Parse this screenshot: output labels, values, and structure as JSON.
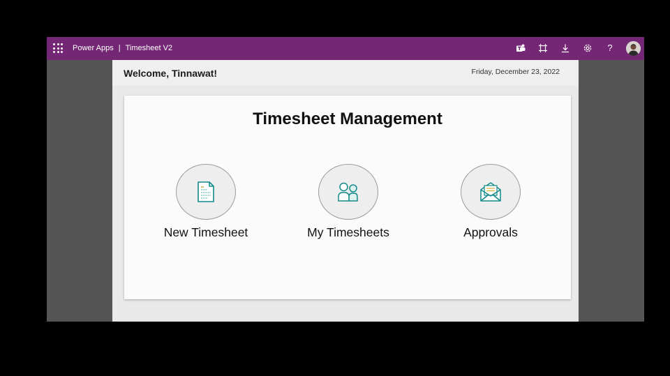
{
  "topbar": {
    "app_name": "Power Apps",
    "separator": "|",
    "app_title": "Timesheet V2",
    "icons": [
      "teams-icon",
      "fit-to-window-icon",
      "download-icon",
      "settings-icon",
      "help-icon",
      "user-avatar"
    ],
    "help_glyph": "?"
  },
  "header": {
    "welcome": "Welcome, Tinnawat!",
    "date": "Friday, December 23, 2022"
  },
  "card": {
    "title": "Timesheet Management",
    "tiles": [
      {
        "label": "New Timesheet",
        "icon": "new-timesheet-icon"
      },
      {
        "label": "My Timesheets",
        "icon": "users-icon"
      },
      {
        "label": "Approvals",
        "icon": "open-envelope-icon"
      }
    ]
  },
  "colors": {
    "topbar": "#742774",
    "icon_teal": "#138a8a",
    "canvas_bg": "#e9e9e9",
    "card_bg": "#fbfbfb"
  }
}
